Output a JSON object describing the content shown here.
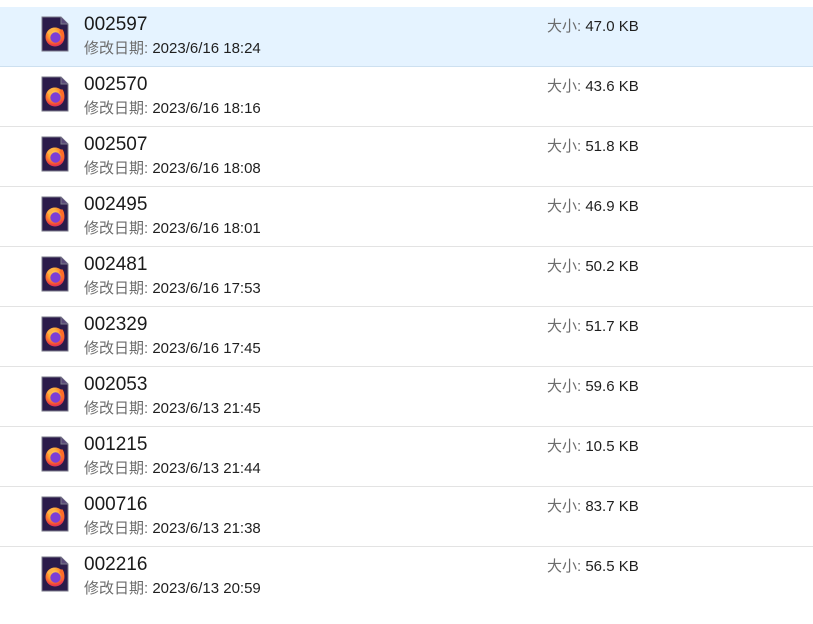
{
  "labels": {
    "modified": "修改日期:",
    "size": "大小:"
  },
  "colors": {
    "selected_row": "#e5f3ff",
    "divider": "#e3e3e3",
    "icon_bg": "#2b1b4a"
  },
  "files": [
    {
      "name": "002597",
      "modified": "2023/6/16 18:24",
      "size": "47.0 KB",
      "icon": "firefox-html-file-icon",
      "selected": true
    },
    {
      "name": "002570",
      "modified": "2023/6/16 18:16",
      "size": "43.6 KB",
      "icon": "firefox-html-file-icon",
      "selected": false
    },
    {
      "name": "002507",
      "modified": "2023/6/16 18:08",
      "size": "51.8 KB",
      "icon": "firefox-html-file-icon",
      "selected": false
    },
    {
      "name": "002495",
      "modified": "2023/6/16 18:01",
      "size": "46.9 KB",
      "icon": "firefox-html-file-icon",
      "selected": false
    },
    {
      "name": "002481",
      "modified": "2023/6/16 17:53",
      "size": "50.2 KB",
      "icon": "firefox-html-file-icon",
      "selected": false
    },
    {
      "name": "002329",
      "modified": "2023/6/16 17:45",
      "size": "51.7 KB",
      "icon": "firefox-html-file-icon",
      "selected": false
    },
    {
      "name": "002053",
      "modified": "2023/6/13 21:45",
      "size": "59.6 KB",
      "icon": "firefox-html-file-icon",
      "selected": false
    },
    {
      "name": "001215",
      "modified": "2023/6/13 21:44",
      "size": "10.5 KB",
      "icon": "firefox-html-file-icon",
      "selected": false
    },
    {
      "name": "000716",
      "modified": "2023/6/13 21:38",
      "size": "83.7 KB",
      "icon": "firefox-html-file-icon",
      "selected": false
    },
    {
      "name": "002216",
      "modified": "2023/6/13 20:59",
      "size": "56.5 KB",
      "icon": "firefox-html-file-icon",
      "selected": false
    }
  ]
}
